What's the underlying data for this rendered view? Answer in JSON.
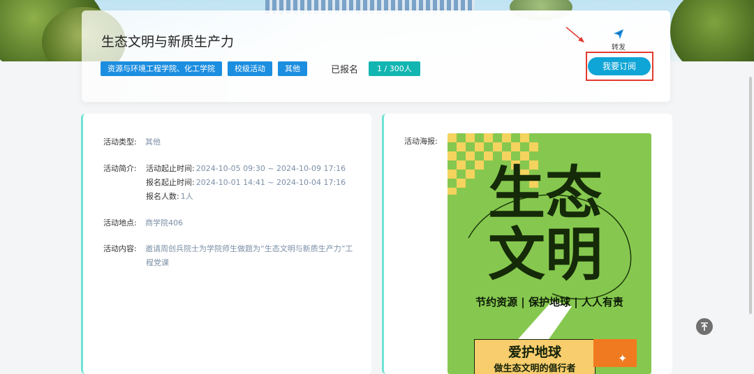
{
  "activity": {
    "title": "生态文明与新质生产力",
    "tags": [
      "资源与环境工程学院、化工学院",
      "校级活动",
      "其他"
    ],
    "enrolled_label": "已报名",
    "enrolled_count": "1 / 300人",
    "share_label": "转发",
    "subscribe_label": "我要订阅"
  },
  "details": {
    "type_label": "活动类型:",
    "type_value": "其他",
    "intro_label": "活动简介:",
    "time_key": "活动起止时间:",
    "time_value": "2024-10-05 09:30 ~ 2024-10-09 17:16",
    "signup_key": "报名起止时间:",
    "signup_value": "2024-10-01 14:41 ~ 2024-10-04 17:16",
    "people_key": "报名人数:",
    "people_value": "1人",
    "location_label": "活动地点:",
    "location_value": "商学院406",
    "content_label": "活动内容:",
    "content_line1": "邀请周创兵院士为学院师生做题为“生态文明与新质生产力”工",
    "content_line2": "程党课"
  },
  "poster": {
    "label": "活动海报:",
    "title_line1": "生态",
    "title_line2": "文明",
    "slogan": "节约资源 | 保护地球 | 人人有责",
    "box_line1": "爱护地球",
    "box_line2": "做生态文明的倡行者"
  },
  "icons": {
    "share": "paper-plane-icon",
    "back_to_top": "arrow-up-icon"
  },
  "colors": {
    "tag_blue": "#1c8ee0",
    "count_teal": "#13b5b1",
    "subscribe_blue": "#0fa5d6",
    "highlight_red": "#e43a2f",
    "poster_green": "#86c84f"
  }
}
